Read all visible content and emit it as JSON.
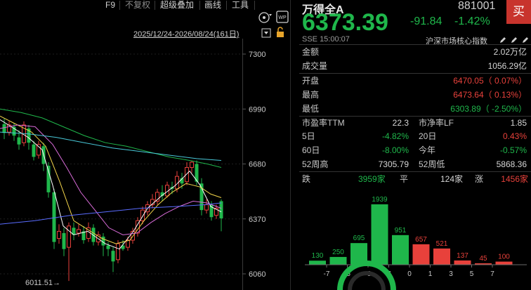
{
  "toolbar": {
    "items": [
      "F9",
      "不复权",
      "超级叠加",
      "画线",
      "工具"
    ],
    "range_label": "2025/12/24-2026/08/24(161日)"
  },
  "chart": {
    "price_axis": [
      "7300",
      "6990",
      "6680",
      "6370",
      "6060"
    ],
    "low_marker": "6011.51→",
    "colors": {
      "up": "#e8413b",
      "down": "#1fb74b",
      "ma5": "#ffffff",
      "ma10": "#f2d44a",
      "ma20": "#d86bd8",
      "ma60": "#1fb74b",
      "ma120": "#49c8d8",
      "ma250": "#5a6cff"
    }
  },
  "quote": {
    "name": "万得全A",
    "code": "881001",
    "buy_label": "买",
    "price": "6373.39",
    "change": "-91.84",
    "change_pct": "-1.42%",
    "exchange_time": "SSE  15:00:07",
    "index_link": "沪深市场核心指数"
  },
  "stats": {
    "amount_label": "金额",
    "amount": "2.02万亿",
    "volume_label": "成交量",
    "volume": "1056.29亿",
    "open_label": "开盘",
    "open": "6470.05（ 0.07%）",
    "high_label": "最高",
    "high": "6473.64（ 0.13%）",
    "low_label": "最低",
    "low": "6303.89（ -2.50%）",
    "pe_label": "市盈率TTM",
    "pe": "22.3",
    "pb_label": "市净率LF",
    "pb": "1.85",
    "d5_label": "5日",
    "d5": "-4.82%",
    "d20_label": "20日",
    "d20": "0.43%",
    "d60_label": "60日",
    "d60": "-8.00%",
    "ytd_label": "今年",
    "ytd": "-0.57%",
    "wk52h_label": "52周高",
    "wk52h": "7305.79",
    "wk52l_label": "52周低",
    "wk52l": "5868.36",
    "down_label": "跌",
    "down_count": "3959家",
    "flat_label": "平",
    "flat_count": "124家",
    "up_label": "涨",
    "up_count": "1456家"
  },
  "chart_data": {
    "type": "bar",
    "categories": [
      "-7",
      "-5",
      "-3",
      "-1",
      "0",
      "1",
      "3",
      "5",
      "7"
    ],
    "x_ticks": [
      "-7",
      "-5",
      "-3",
      "-1",
      "0",
      "1",
      "3",
      "5",
      "7"
    ],
    "values": [
      130,
      250,
      695,
      1939,
      951,
      657,
      521,
      137,
      45,
      100
    ],
    "bar_colors": [
      "#1fb74b",
      "#1fb74b",
      "#1fb74b",
      "#1fb74b",
      "#1fb74b",
      "#e8413b",
      "#e8413b",
      "#e8413b",
      "#e8413b",
      "#e8413b"
    ]
  }
}
